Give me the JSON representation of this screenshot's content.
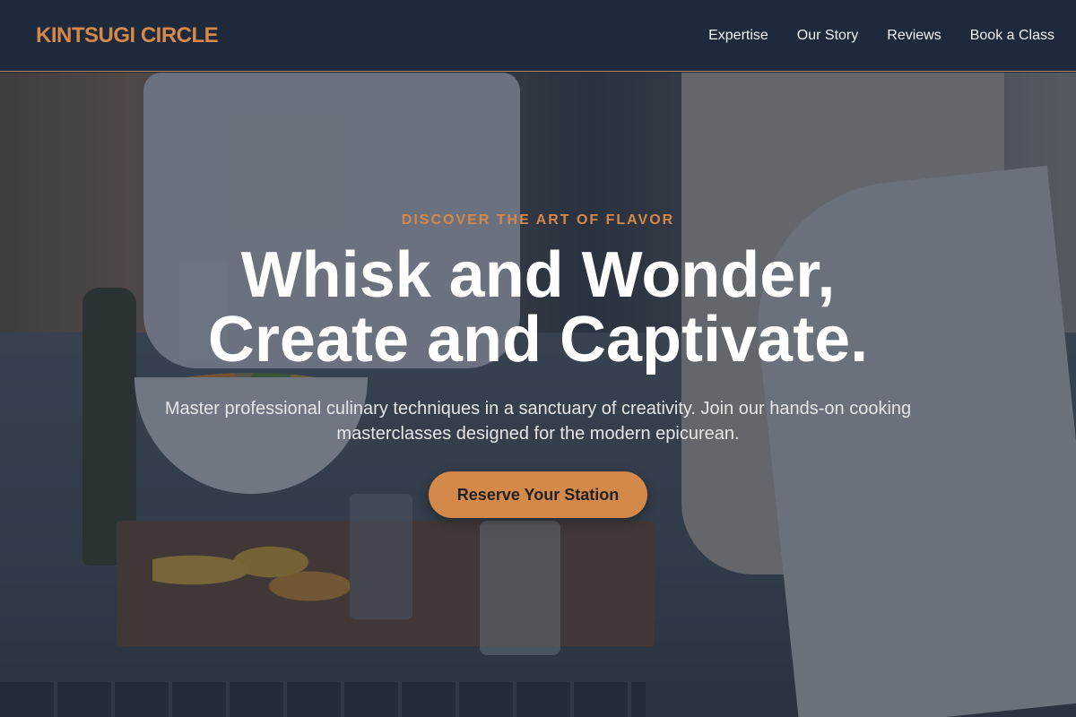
{
  "header": {
    "brand": "KINTSUGI CIRCLE",
    "nav": [
      "Expertise",
      "Our Story",
      "Reviews",
      "Book a Class"
    ]
  },
  "hero": {
    "eyebrow": "DISCOVER THE ART OF FLAVOR",
    "headline_line1": "Whisk and Wonder,",
    "headline_line2": "Create and Captivate.",
    "subtext": "Master professional culinary techniques in a sanctuary of creativity. Join our hands-on cooking masterclasses designed for the modern epicurean.",
    "cta_label": "Reserve Your Station"
  },
  "colors": {
    "accent": "#d4894a",
    "header_bg": "#1e2a3c"
  }
}
